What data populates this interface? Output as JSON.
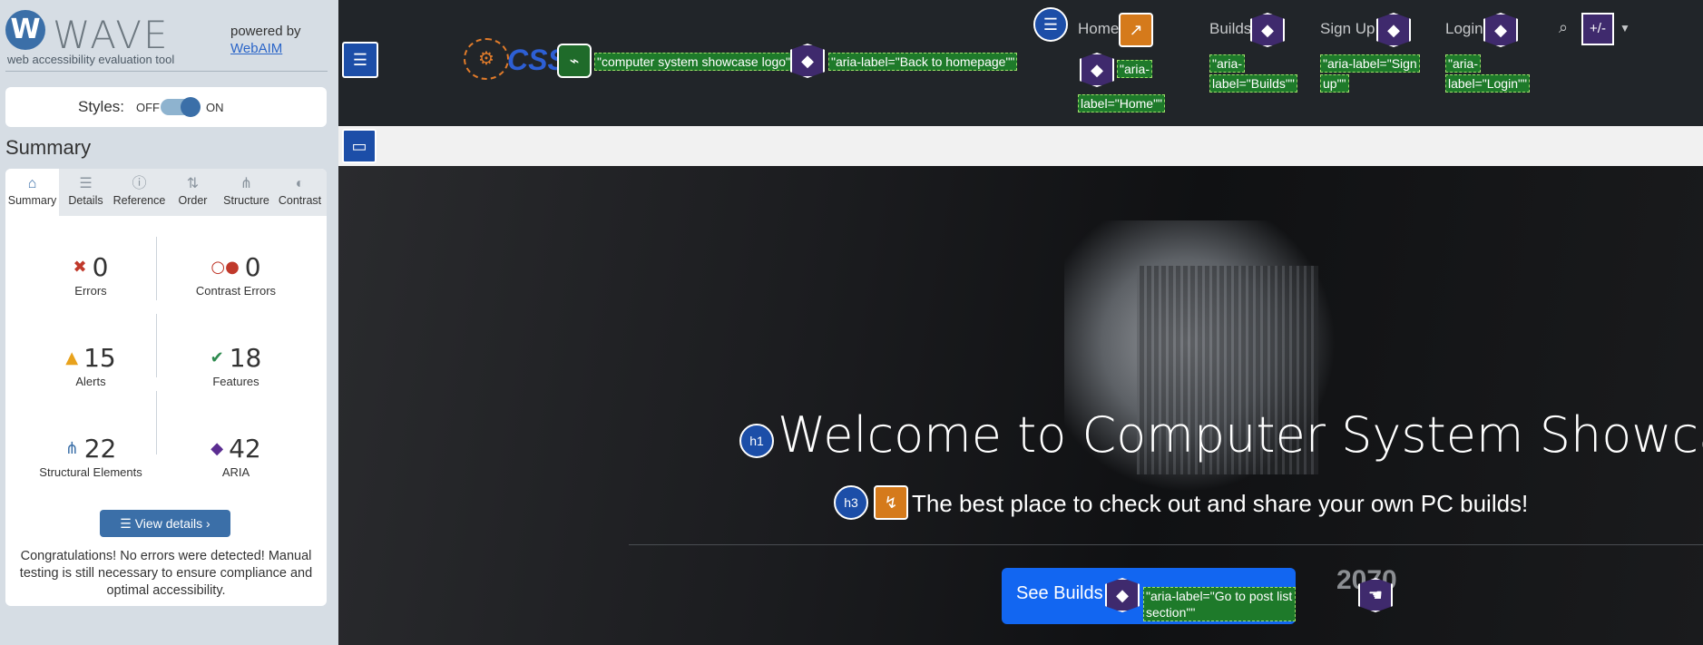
{
  "wave": {
    "logo_letter": "W",
    "logo_text": "WAVE",
    "tagline": "web accessibility evaluation tool",
    "powered_by": "powered by",
    "webaim_link": "WebAIM",
    "styles_label": "Styles:",
    "styles_off": "OFF",
    "styles_on": "ON",
    "summary_heading": "Summary",
    "tabs": [
      {
        "label": "Summary",
        "icon": "home-icon",
        "glyph": "⌂"
      },
      {
        "label": "Details",
        "icon": "list-icon",
        "glyph": "☰"
      },
      {
        "label": "Reference",
        "icon": "info-icon",
        "glyph": "ⓘ"
      },
      {
        "label": "Order",
        "icon": "order-icon",
        "glyph": "⇅"
      },
      {
        "label": "Structure",
        "icon": "structure-icon",
        "glyph": "⋔"
      },
      {
        "label": "Contrast",
        "icon": "contrast-icon",
        "glyph": "◐"
      }
    ],
    "stats": {
      "errors": {
        "value": "0",
        "label": "Errors",
        "color": "#c0392b"
      },
      "contrast_errors": {
        "value": "0",
        "label": "Contrast Errors",
        "color": "#c0392b"
      },
      "alerts": {
        "value": "15",
        "label": "Alerts",
        "color": "#e8a21c"
      },
      "features": {
        "value": "18",
        "label": "Features",
        "color": "#2e8b4f"
      },
      "structural": {
        "value": "22",
        "label": "Structural Elements",
        "color": "#3b6fa8"
      },
      "aria": {
        "value": "42",
        "label": "ARIA",
        "color": "#5b2d91"
      }
    },
    "view_details": "View details ›",
    "congrats": "Congratulations! No errors were detected! Manual testing is still necessary to ensure compliance and optimal accessibility."
  },
  "site": {
    "logo_text": "CSS",
    "nav": {
      "home": "Home",
      "builds": "Builds",
      "signup": "Sign Up!",
      "login": "Login"
    },
    "annotations": {
      "logo_alt": "\"computer system showcase logo\"",
      "back_home": "\"aria-label=\"Back to homepage\"\"",
      "home_1": "\"aria-",
      "home_2": "label=\"Home\"\"",
      "builds_1": "\"aria-",
      "builds_2": "label=\"Builds\"\"",
      "signup_1": "\"aria-label=\"Sign",
      "signup_2": "up\"\"",
      "login_1": "\"aria-",
      "login_2": "label=\"Login\"\"",
      "post_list": "\"aria-label=\"Go to post list section\"\""
    },
    "toggle_label": "+/-",
    "h1_tag": "h1",
    "h3_tag": "h3",
    "hero_title": "Welcome to Computer System Showcase!",
    "hero_sub": "The best place to check out and share your own PC builds!",
    "see_builds": "See Builds",
    "gpu_text": "2070"
  },
  "colors": {
    "wave_blue": "#3b6fa8",
    "navbar": "#212529",
    "button_blue": "#1266f1",
    "aria_purple": "#3f2a6d",
    "annotation_green": "#1e7a2a"
  }
}
